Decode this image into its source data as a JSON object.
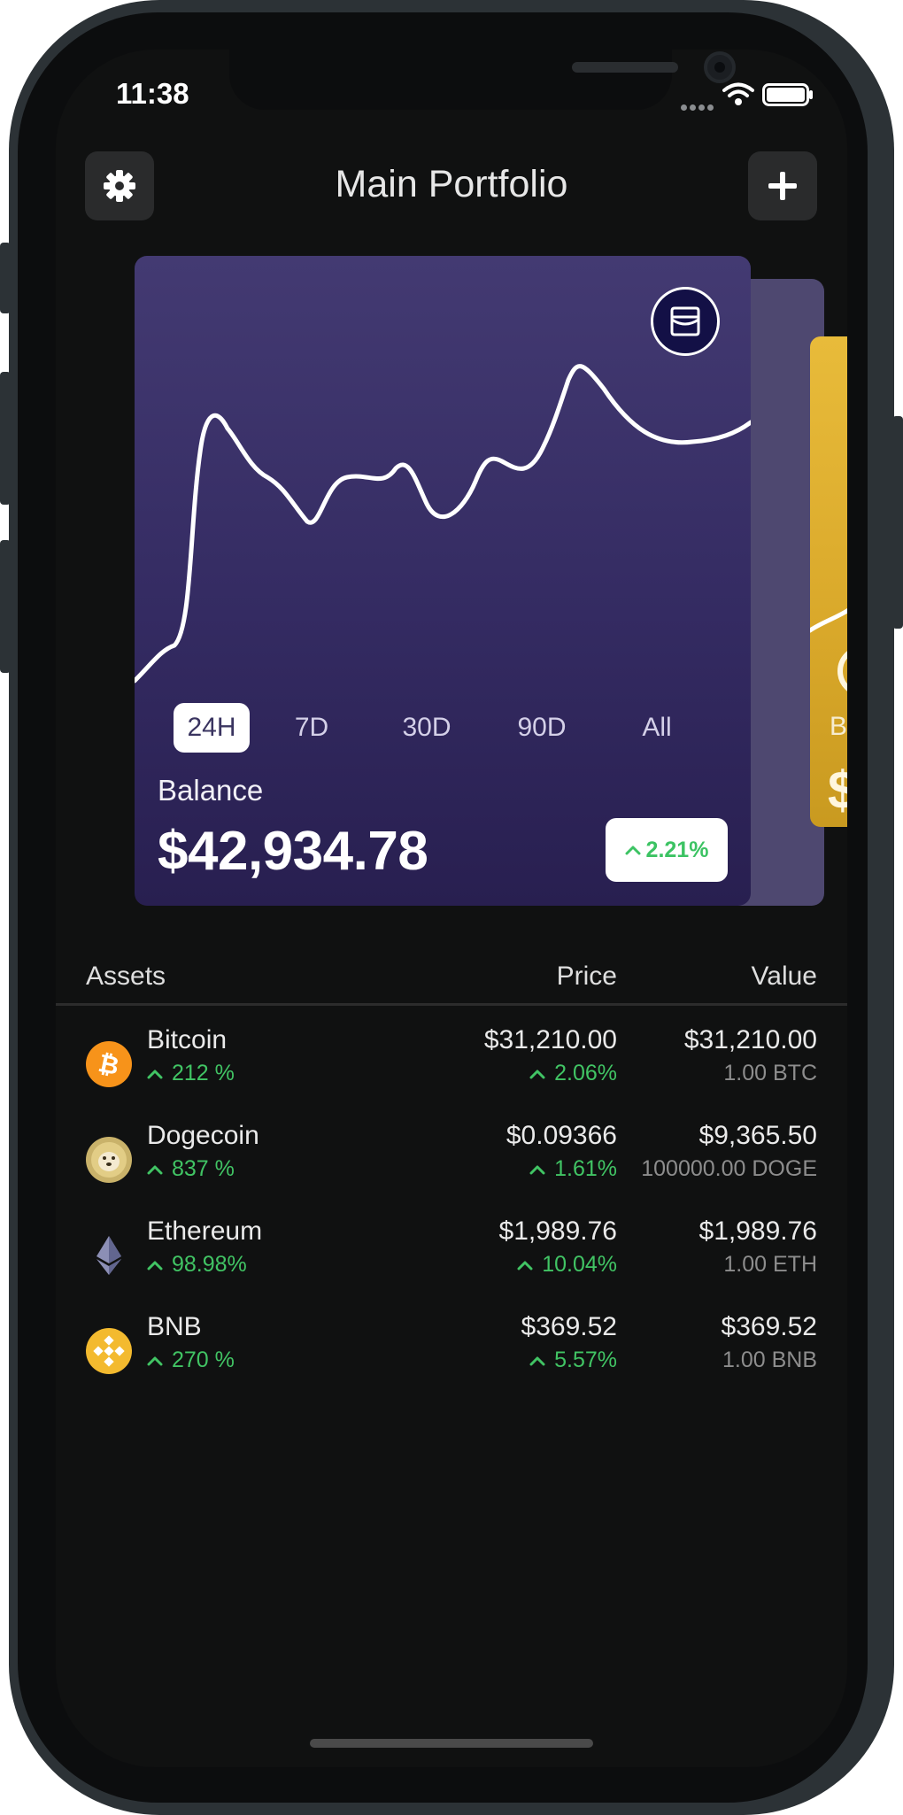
{
  "status_bar": {
    "time": "11:38",
    "icons": [
      "signal-dots-icon",
      "wifi-icon",
      "battery-icon"
    ]
  },
  "header": {
    "title": "Main Portfolio",
    "left_button_icon": "gear-icon",
    "right_button_icon": "plus-icon"
  },
  "portfolio_card": {
    "badge_icon": "wallet-icon",
    "time_ranges": [
      "24H",
      "7D",
      "30D",
      "90D",
      "All"
    ],
    "active_range": "24H",
    "balance_label": "Balance",
    "balance_value": "$42,934.78",
    "change": "2.21%",
    "change_direction": "up",
    "colors": {
      "card_top": "#433a72",
      "card_bottom": "#281f50",
      "change_positive": "#3cc363"
    }
  },
  "next_card": {
    "label": "B",
    "value": "$",
    "color": "#e0b230"
  },
  "assets_table": {
    "headers": {
      "assets": "Assets",
      "price": "Price",
      "value": "Value"
    },
    "rows": [
      {
        "name": "Bitcoin",
        "icon": "bitcoin-icon",
        "change": "212 %",
        "price": "$31,210.00",
        "price_change": "2.06%",
        "value": "$31,210.00",
        "holding": "1.00 BTC"
      },
      {
        "name": "Dogecoin",
        "icon": "dogecoin-icon",
        "change": "837 %",
        "price": "$0.09366",
        "price_change": "1.61%",
        "value": "$9,365.50",
        "holding": "100000.00 DOGE"
      },
      {
        "name": "Ethereum",
        "icon": "ethereum-icon",
        "change": "98.98%",
        "price": "$1,989.76",
        "price_change": "10.04%",
        "value": "$1,989.76",
        "holding": "1.00 ETH"
      },
      {
        "name": "BNB",
        "icon": "bnb-icon",
        "change": "270 %",
        "price": "$369.52",
        "price_change": "5.57%",
        "value": "$369.52",
        "holding": "1.00 BNB"
      }
    ]
  }
}
